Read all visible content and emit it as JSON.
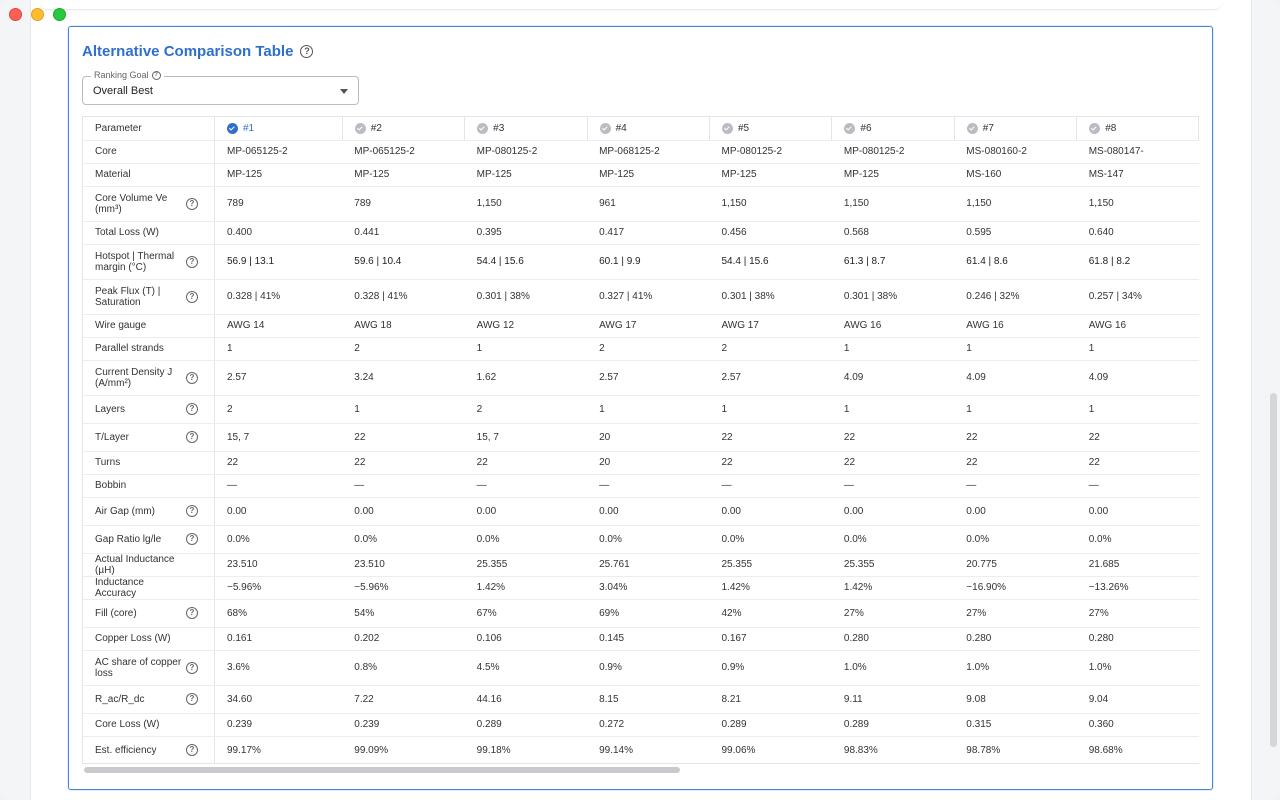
{
  "card": {
    "title": "Alternative Comparison Table"
  },
  "ranking": {
    "legend": "Ranking Goal",
    "value": "Overall Best"
  },
  "table": {
    "param_header": "Parameter",
    "columns": [
      "#1",
      "#2",
      "#3",
      "#4",
      "#5",
      "#6",
      "#7",
      "#8"
    ],
    "active_column": 0,
    "rows": [
      {
        "label": "Core",
        "help": false,
        "values": [
          "MP-065125-2",
          "MP-065125-2",
          "MP-080125-2",
          "MP-068125-2",
          "MP-080125-2",
          "MP-080125-2",
          "MS-080160-2",
          "MS-080147-"
        ]
      },
      {
        "label": "Material",
        "help": false,
        "values": [
          "MP-125",
          "MP-125",
          "MP-125",
          "MP-125",
          "MP-125",
          "MP-125",
          "MS-160",
          "MS-147"
        ]
      },
      {
        "label": "Core Volume Ve (mm³)",
        "help": true,
        "values": [
          "789",
          "789",
          "1,150",
          "961",
          "1,150",
          "1,150",
          "1,150",
          "1,150"
        ]
      },
      {
        "label": "Total Loss (W)",
        "help": false,
        "values": [
          "0.400",
          "0.441",
          "0.395",
          "0.417",
          "0.456",
          "0.568",
          "0.595",
          "0.640"
        ]
      },
      {
        "label": "Hotspot | Thermal margin (°C)",
        "help": true,
        "values": [
          "56.9 | 13.1",
          "59.6 | 10.4",
          "54.4 | 15.6",
          "60.1 | 9.9",
          "54.4 | 15.6",
          "61.3 | 8.7",
          "61.4 | 8.6",
          "61.8 | 8.2"
        ]
      },
      {
        "label": "Peak Flux (T) | Saturation",
        "help": true,
        "values": [
          "0.328 | 41%",
          "0.328 | 41%",
          "0.301 | 38%",
          "0.327 | 41%",
          "0.301 | 38%",
          "0.301 | 38%",
          "0.246 | 32%",
          "0.257 | 34%"
        ]
      },
      {
        "label": "Wire gauge",
        "help": false,
        "values": [
          "AWG 14",
          "AWG 18",
          "AWG 12",
          "AWG 17",
          "AWG 17",
          "AWG 16",
          "AWG 16",
          "AWG 16"
        ]
      },
      {
        "label": "Parallel strands",
        "help": false,
        "values": [
          "1",
          "2",
          "1",
          "2",
          "2",
          "1",
          "1",
          "1"
        ]
      },
      {
        "label": "Current Density J (A/mm²)",
        "help": true,
        "values": [
          "2.57",
          "3.24",
          "1.62",
          "2.57",
          "2.57",
          "4.09",
          "4.09",
          "4.09"
        ]
      },
      {
        "label": "Layers",
        "help": true,
        "values": [
          "2",
          "1",
          "2",
          "1",
          "1",
          "1",
          "1",
          "1"
        ]
      },
      {
        "label": "T/Layer",
        "help": true,
        "values": [
          "15, 7",
          "22",
          "15, 7",
          "20",
          "22",
          "22",
          "22",
          "22"
        ]
      },
      {
        "label": "Turns",
        "help": false,
        "values": [
          "22",
          "22",
          "22",
          "20",
          "22",
          "22",
          "22",
          "22"
        ]
      },
      {
        "label": "Bobbin",
        "help": false,
        "values": [
          "—",
          "—",
          "—",
          "—",
          "—",
          "—",
          "—",
          "—"
        ]
      },
      {
        "label": "Air Gap (mm)",
        "help": true,
        "values": [
          "0.00",
          "0.00",
          "0.00",
          "0.00",
          "0.00",
          "0.00",
          "0.00",
          "0.00"
        ]
      },
      {
        "label": "Gap Ratio lg/le",
        "help": true,
        "values": [
          "0.0%",
          "0.0%",
          "0.0%",
          "0.0%",
          "0.0%",
          "0.0%",
          "0.0%",
          "0.0%"
        ]
      },
      {
        "label": "Actual Inductance (µH)",
        "help": false,
        "values": [
          "23.510",
          "23.510",
          "25.355",
          "25.761",
          "25.355",
          "25.355",
          "20.775",
          "21.685"
        ]
      },
      {
        "label": "Inductance Accuracy",
        "help": false,
        "values": [
          "−5.96%",
          "−5.96%",
          "1.42%",
          "3.04%",
          "1.42%",
          "1.42%",
          "−16.90%",
          "−13.26%"
        ]
      },
      {
        "label": "Fill (core)",
        "help": true,
        "values": [
          "68%",
          "54%",
          "67%",
          "69%",
          "42%",
          "27%",
          "27%",
          "27%"
        ]
      },
      {
        "label": "Copper Loss (W)",
        "help": false,
        "values": [
          "0.161",
          "0.202",
          "0.106",
          "0.145",
          "0.167",
          "0.280",
          "0.280",
          "0.280"
        ]
      },
      {
        "label": "AC share of copper loss",
        "help": true,
        "values": [
          "3.6%",
          "0.8%",
          "4.5%",
          "0.9%",
          "0.9%",
          "1.0%",
          "1.0%",
          "1.0%"
        ]
      },
      {
        "label": "R_ac/R_dc",
        "help": true,
        "values": [
          "34.60",
          "7.22",
          "44.16",
          "8.15",
          "8.21",
          "9.11",
          "9.08",
          "9.04"
        ]
      },
      {
        "label": "Core Loss (W)",
        "help": false,
        "values": [
          "0.239",
          "0.239",
          "0.289",
          "0.272",
          "0.289",
          "0.289",
          "0.315",
          "0.360"
        ]
      },
      {
        "label": "Est. efficiency",
        "help": true,
        "values": [
          "99.17%",
          "99.09%",
          "99.18%",
          "99.14%",
          "99.06%",
          "98.83%",
          "98.78%",
          "98.68%"
        ]
      }
    ]
  }
}
